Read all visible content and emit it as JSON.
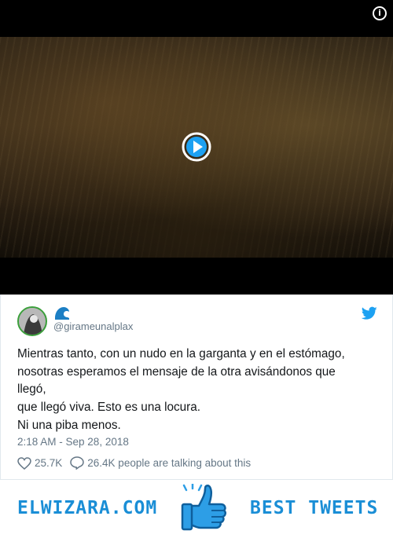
{
  "video": {
    "info_icon": "info-icon",
    "play_icon": "play-circle-icon"
  },
  "tweet": {
    "display_name_icon": "wave-emoji-icon",
    "handle": "@girameunalplax",
    "text": "Mientras tanto, con un nudo en la garganta y en el estómago,\nnosotras esperamos el mensaje de la otra avisándonos que\nllegó,\nque llegó viva. Esto es una locura.\nNi una piba menos.",
    "timestamp": "2:18 AM - Sep 28, 2018",
    "likes": "25.7K",
    "talking": "26.4K people are talking about this",
    "brand_icon": "twitter-bird-icon",
    "colors": {
      "twitter_blue": "#1da1f2",
      "muted": "#657786"
    }
  },
  "banner": {
    "left_text": "ELWIZARA.COM",
    "right_text": "BEST TWEETS",
    "center_icon": "thumbs-up-icon",
    "color": "#1a8ed6"
  }
}
